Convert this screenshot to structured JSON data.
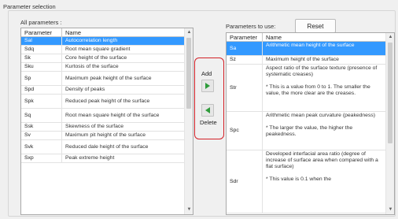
{
  "group_title": "Parameter selection",
  "all_params_label": "All parameters :",
  "params_to_use_label": "Parameters to use:",
  "reset_label": "Reset",
  "add_label": "Add",
  "delete_label": "Delete",
  "columns": {
    "parameter": "Parameter",
    "name": "Name"
  },
  "all_params": [
    {
      "param": "Sal",
      "name": "Autocorrelation length"
    },
    {
      "param": "Sdq",
      "name": "Root mean square gradient"
    },
    {
      "param": "Sk",
      "name": "Core height of the surface"
    },
    {
      "param": "Sku",
      "name": "Kurtosis of the surface"
    },
    {
      "param": "Sp",
      "name": "Maximum peak height of the surface"
    },
    {
      "param": "Spd",
      "name": "Density of peaks"
    },
    {
      "param": "Spk",
      "name": "Reduced peak height of the surface"
    },
    {
      "param": "Sq",
      "name": "Root mean square height of the surface"
    },
    {
      "param": "Ssk",
      "name": "Skewness of the surface"
    },
    {
      "param": "Sv",
      "name": "Maximum pit height of the surface"
    },
    {
      "param": "Svk",
      "name": "Reduced dale height of the surface"
    },
    {
      "param": "Sxp",
      "name": "Peak extreme height"
    }
  ],
  "use_params": [
    {
      "param": "Sa",
      "name": "Arithmetic mean height of the surface"
    },
    {
      "param": "Sz",
      "name": "Maximum height of the surface"
    },
    {
      "param": "Str",
      "name": "Aspect ratio of the surface texture (presence of systematic creases)\n\n* This is a value from 0 to 1. The smaller the value, the more clear are the creases."
    },
    {
      "param": "Spc",
      "name": "Arithmetic mean peak curvature (peakedness)\n\n* The larger the value, the higher the peakedness."
    },
    {
      "param": "Sdr",
      "name": "Developed interfacial area ratio (degree of increase of surface area when compared with a flat surface)\n\n* This value is 0.1 when the"
    }
  ],
  "colors": {
    "selection": "#3399ff",
    "highlight_border": "#d32027",
    "arrow_green": "#2e9b3a"
  },
  "icons": {
    "add_arrow": "right-arrow-icon",
    "delete_arrow": "left-arrow-icon"
  }
}
